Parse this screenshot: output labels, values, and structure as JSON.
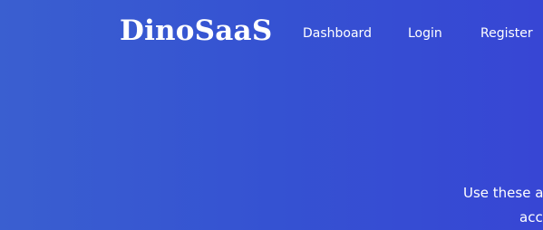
{
  "brand": {
    "name": "DinoSaaS"
  },
  "nav": {
    "items": [
      {
        "label": "Dashboard"
      },
      {
        "label": "Login"
      },
      {
        "label": "Register"
      }
    ]
  },
  "hero": {
    "line1": "Use these aw",
    "line2": "acco"
  },
  "colors": {
    "background_start": "#3a5fd0",
    "background_end": "#3746d4",
    "text": "#ffffff"
  }
}
